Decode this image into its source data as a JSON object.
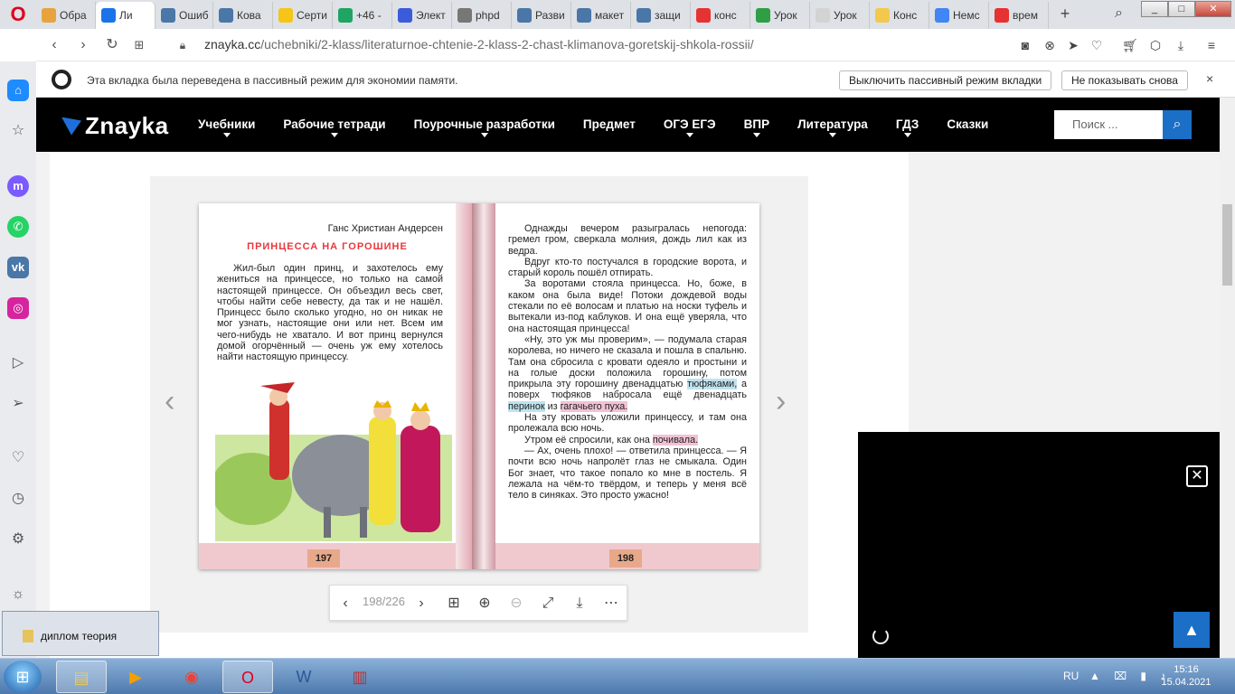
{
  "browser": {
    "tabs": [
      {
        "label": "Обра",
        "color": "#e8a33d"
      },
      {
        "label": "Ли",
        "color": "#1a73e8",
        "active": true
      },
      {
        "label": "Ошиб",
        "color": "#4a76a8"
      },
      {
        "label": "Кова",
        "color": "#4a76a8"
      },
      {
        "label": "Серти",
        "color": "#f5c518"
      },
      {
        "label": "+46 -",
        "color": "#1fa463"
      },
      {
        "label": "Элект",
        "color": "#3b5bdb"
      },
      {
        "label": "phpd",
        "color": "#777777"
      },
      {
        "label": "Разви",
        "color": "#4a76a8"
      },
      {
        "label": "макет",
        "color": "#4a76a8"
      },
      {
        "label": "защи",
        "color": "#4a76a8"
      },
      {
        "label": "конс",
        "color": "#e63232"
      },
      {
        "label": "Урок",
        "color": "#2f9e44"
      },
      {
        "label": "Урок",
        "color": "#d3d3d3"
      },
      {
        "label": "Конс",
        "color": "#f2c94c"
      },
      {
        "label": "Немс",
        "color": "#4285f4"
      },
      {
        "label": "врем",
        "color": "#e63232"
      }
    ],
    "new_tab": "+",
    "window_controls": {
      "minimize": "_",
      "maximize": "□",
      "close": "✕"
    },
    "url_host": "znayka.cc",
    "url_path": "/uchebniki/2-klass/literaturnoe-chtenie-2-klass-2-chast-klimanova-goretskij-shkola-rossii/"
  },
  "notification": {
    "text": "Эта вкладка была переведена в пассивный режим для экономии памяти.",
    "disable_button": "Выключить пассивный режим вкладки",
    "dont_show_button": "Не показывать снова",
    "close": "×"
  },
  "site": {
    "logo": "Znayka",
    "menu": [
      "Учебники",
      "Рабочие тетради",
      "Поурочные разработки",
      "Предмет",
      "ОГЭ ЕГЭ",
      "ВПР",
      "Литература",
      "ГДЗ",
      "Сказки"
    ],
    "menu_has_caret": [
      true,
      true,
      true,
      false,
      true,
      true,
      true,
      true,
      false
    ],
    "search_placeholder": "Поиск ..."
  },
  "book": {
    "author": "Ганс Христиан Андерсен",
    "title": "ПРИНЦЕССА НА ГОРОШИНЕ",
    "left_text": "Жил-был один принц, и захотелось ему жениться на принцессе, но только на самой настоящей принцессе. Он объездил весь свет, чтобы найти себе невесту, да так и не нашёл. Принцесс было сколько угодно, но он никак не мог узнать, настоящие они или нет. Всем им чего-нибудь не хватало. И вот принц вернулся домой огорчённый — очень уж ему хотелось найти настоящую принцессу.",
    "right_p1": "Однажды вечером разыгралась непогода: гремел гром, сверкала молния, дождь лил как из ведра.",
    "right_p2": "Вдруг кто-то постучался в городские ворота, и старый король пошёл отпирать.",
    "right_p3": "За воротами стояла принцесса. Но, боже, в каком она была виде! Потоки дождевой воды стекали по её волосам и платью на носки туфель и вытекали из-под каблуков. И она ещё уверяла, что она настоящая принцесса!",
    "right_p4a": "«Ну, это уж мы проверим», — подумала старая королева, но ничего не сказала и пошла в спальню. Там она сбросила с кровати одеяло и простыни и на голые доски положила горошину, потом прикрыла эту горошину двенадцатью",
    "hl_tufyaki": "тюфяками,",
    "right_p4b": "а поверх тюфяков набросала ещё двенадцать",
    "hl_perinok": "перинок",
    "right_p4c": "из",
    "hl_pukh": "гагачьего пуха.",
    "right_p5": "На эту кровать уложили принцессу, и там она пролежала всю ночь.",
    "right_p6a": "Утром её спросили, как она",
    "hl_pochivala": "почивала.",
    "right_p7": "— Ах, очень плохо! — ответила принцесса. — Я почти всю ночь напролёт глаз не смыкала. Один Бог знает, что такое попало ко мне в постель. Я лежала на чём-то твёрдом, и теперь у меня всё тело в синяках. Это просто ужасно!",
    "page_left": "197",
    "page_right": "198"
  },
  "viewer": {
    "page_indicator": "198/226",
    "prev": "‹",
    "next": "›"
  },
  "downloads": {
    "label": "диплом теория"
  },
  "taskbar": {
    "lang": "RU",
    "time": "15:16",
    "date": "15.04.2021"
  }
}
